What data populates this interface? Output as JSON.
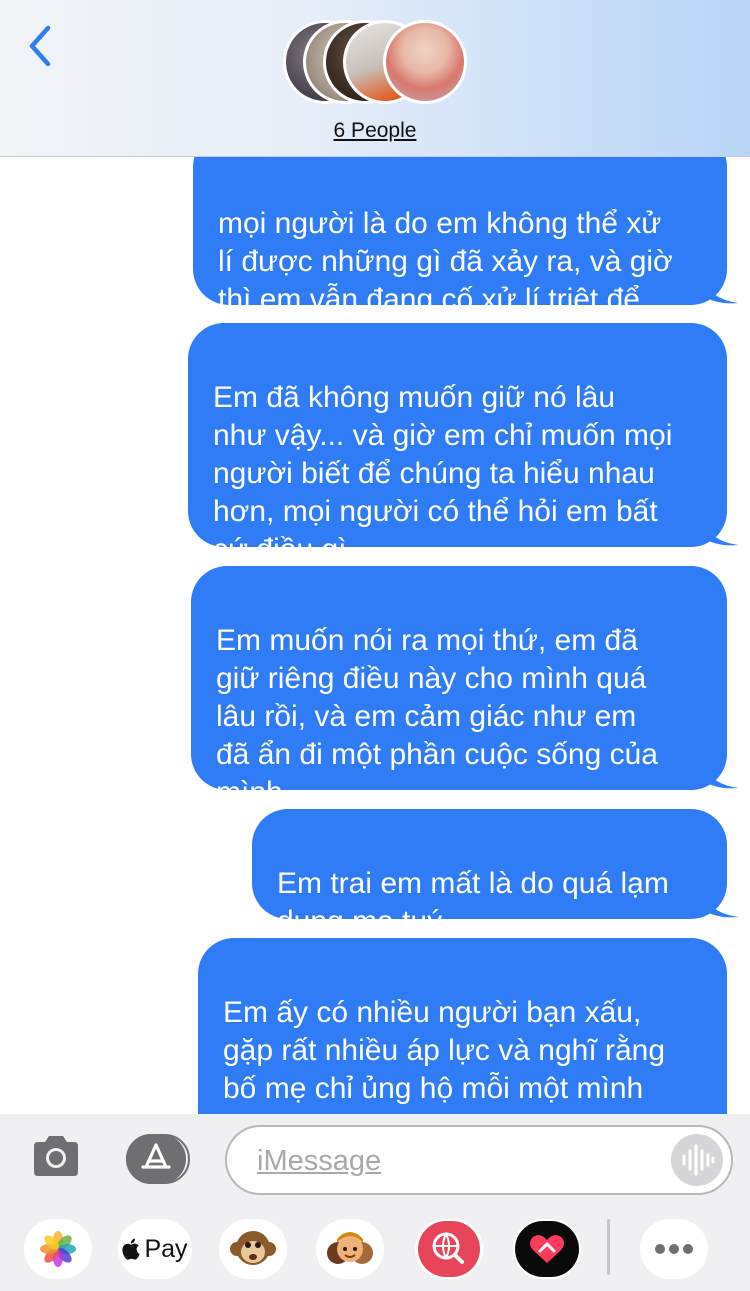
{
  "header": {
    "group_label": "6 People"
  },
  "messages": [
    {
      "text": "mọi người là do em không thể xử\nlí được những gì đã xảy ra, và giờ\nthì em vẫn đang cố xử lí triệt để\nviệc này"
    },
    {
      "text": "Em đã không muốn giữ nó lâu\nnhư vậy... và giờ em chỉ muốn mọi\nngười biết để chúng ta hiểu nhau\nhơn, mọi người có thể hỏi em bất\ncứ điều gì"
    },
    {
      "text": "Em muốn nói ra mọi thứ, em đã\ngiữ riêng điều này cho mình quá\nlâu rồi, và em cảm giác như em\nđã ẩn đi một phần cuộc sống của\nmình"
    },
    {
      "text": "Em trai em mất là do quá lạm\ndụng ma tuý"
    },
    {
      "text": "Em ấy có nhiều người bạn xấu,\ngặp rất nhiều áp lực và nghĩ rằng\nbố mẹ chỉ ủng hộ mỗi một mình\nem"
    }
  ],
  "composer": {
    "placeholder": "iMessage",
    "apple_pay_label": "Pay"
  },
  "colors": {
    "bubble": "#2f7cf6",
    "accent": "#2f7cf6",
    "header_gradient_end": "#b8d5f7"
  },
  "icons": [
    "back-chevron-icon",
    "camera-icon",
    "app-store-icon",
    "audio-waveform-icon",
    "photos-icon",
    "apple-logo-icon",
    "monkey-emoji-icon",
    "memoji-icon",
    "web-search-icon",
    "heart-sticker-icon",
    "more-icon"
  ]
}
